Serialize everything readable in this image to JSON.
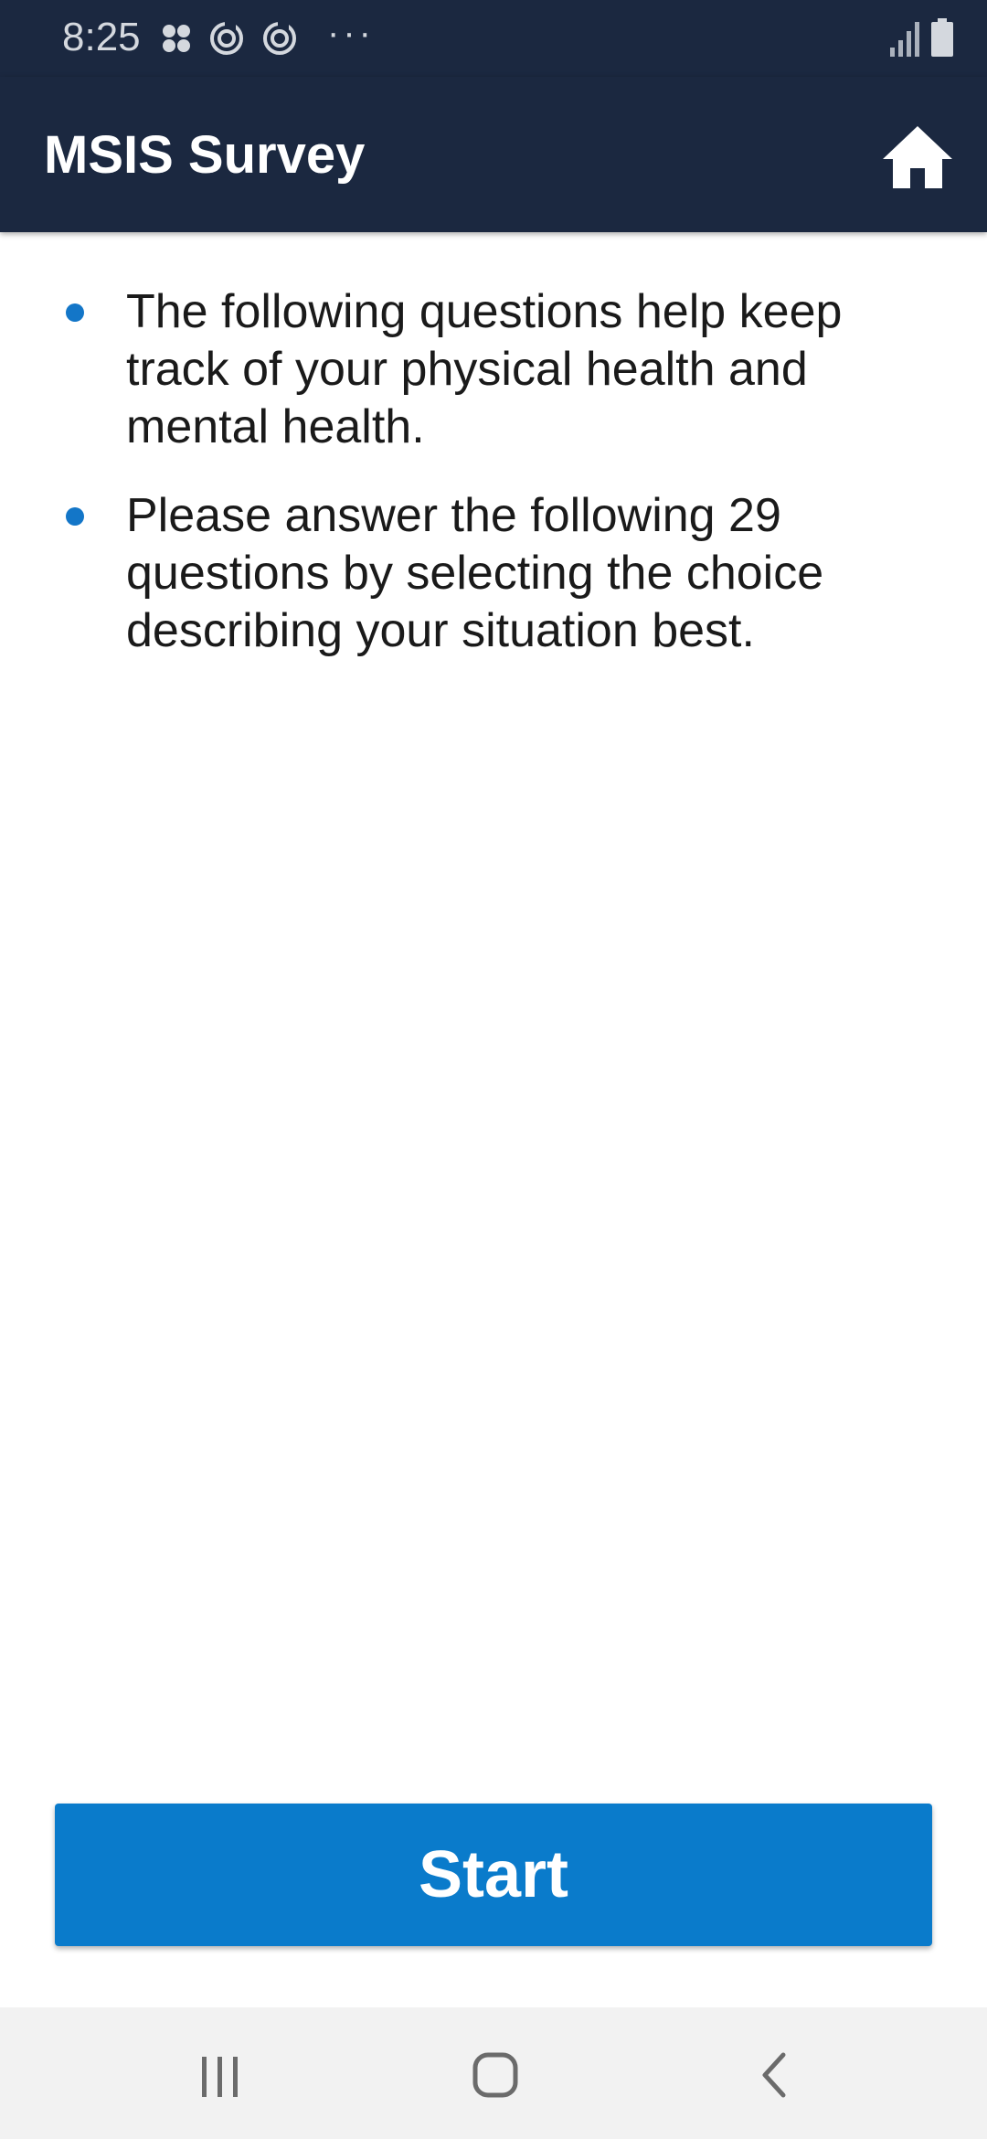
{
  "status_bar": {
    "time": "8:25",
    "icons_left": [
      "apps-grid-icon",
      "sync-icon",
      "sync-icon"
    ],
    "more_indicator": "···",
    "icons_right": [
      "signal-icon",
      "battery-icon"
    ]
  },
  "app_bar": {
    "title": "MSIS Survey",
    "home_icon": "home-icon"
  },
  "intro": {
    "bullets": [
      "The following questions help keep track of your physical health and mental health.",
      "Please answer the following 29 questions by selecting the choice describing your situation best."
    ]
  },
  "actions": {
    "start_label": "Start"
  },
  "nav_bar": {
    "items": [
      "recents-icon",
      "home-icon",
      "back-icon"
    ]
  },
  "colors": {
    "header_bg": "#1b2840",
    "accent": "#0a7bcb",
    "bullet": "#1376c8",
    "nav_bg": "#f2f2f2"
  }
}
